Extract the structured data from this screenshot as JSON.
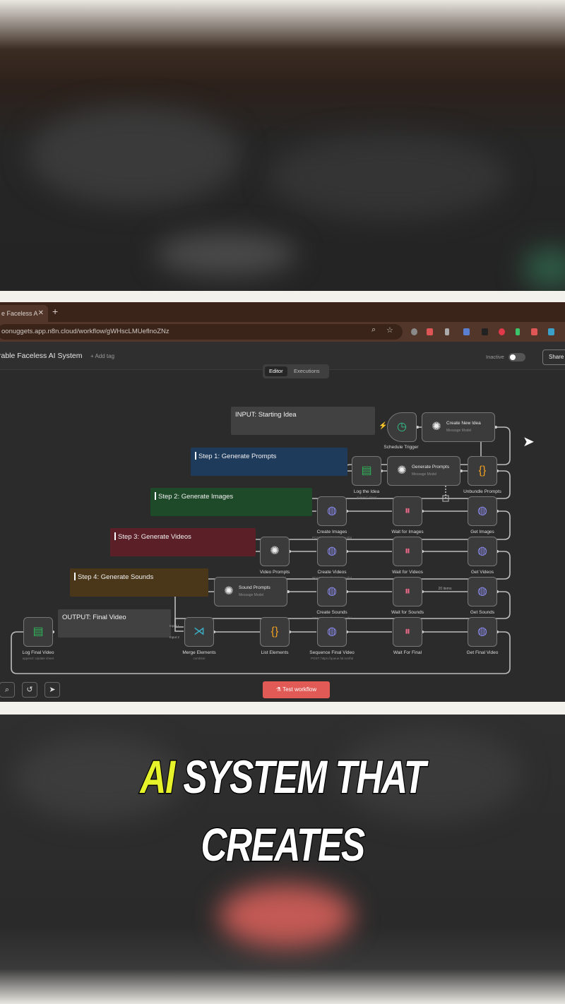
{
  "browser": {
    "tab_title": "e Faceless A",
    "tab_close": "✕",
    "new_tab": "+",
    "url": "oonuggets.app.n8n.cloud/workflow/gWHscLMUeflnoZNz"
  },
  "app": {
    "workflow_name": "rable Faceless AI System",
    "add_tag": "+ Add tag",
    "status": "Inactive",
    "share": "Share",
    "tabs": [
      "Editor",
      "Executions"
    ]
  },
  "stickies": {
    "input": "INPUT: Starting Idea",
    "step1": "Step 1: Generate Prompts",
    "step2": "Step 2: Generate Images",
    "step3": "Step 3: Generate Videos",
    "step4": "Step 4: Generate Sounds",
    "output": "OUTPUT: Final Video"
  },
  "nodes": {
    "schedule_trigger": {
      "label": "Schedule Trigger",
      "icon": "clock-icon"
    },
    "create_new_idea": {
      "title": "Create New Idea",
      "subtitle": "Message Model",
      "icon": "openai-icon"
    },
    "log_the_idea": {
      "label": "Log the Idea",
      "subtitle": "append: sheet",
      "icon": "google-sheets-icon"
    },
    "generate_prompts": {
      "title": "Generate Prompts",
      "subtitle": "Message Model",
      "icon": "openai-icon"
    },
    "unbundle_prompts": {
      "label": "Unbundle Prompts",
      "icon": "code-braces-icon"
    },
    "create_images": {
      "label": "Create Images",
      "subtitle": "POST: https://api.dev.run/fal",
      "icon": "globe-icon"
    },
    "wait_images": {
      "label": "Wait for Images",
      "icon": "pause-icon"
    },
    "get_images": {
      "label": "Get Images",
      "icon": "globe-icon"
    },
    "video_prompts": {
      "label": "Video Prompts",
      "subtitle": "Message Model",
      "icon": "openai-icon"
    },
    "create_videos": {
      "label": "Create Videos",
      "subtitle": "POST: https://api.dev.run/fal",
      "icon": "globe-icon"
    },
    "wait_videos": {
      "label": "Wait for Videos",
      "icon": "pause-icon"
    },
    "get_videos": {
      "label": "Get Videos",
      "icon": "globe-icon"
    },
    "sound_prompts": {
      "title": "Sound Prompts",
      "subtitle": "Message Model",
      "icon": "openai-icon"
    },
    "create_sounds": {
      "label": "Create Sounds",
      "subtitle": "POST: https://api.dev.run/fal",
      "icon": "globe-icon"
    },
    "wait_sounds": {
      "label": "Wait for Sounds",
      "icon": "pause-icon"
    },
    "get_sounds": {
      "label": "Get Sounds",
      "icon": "globe-icon"
    },
    "log_final_video": {
      "label": "Log Final Video",
      "subtitle": "append: Update sheet",
      "icon": "google-sheets-icon"
    },
    "merge_elements": {
      "label": "Merge Elements",
      "subtitle": "combine",
      "icon": "merge-icon"
    },
    "list_elements": {
      "label": "List Elements",
      "icon": "code-braces-icon"
    },
    "sequence_final_video": {
      "label": "Sequence Final Video",
      "subtitle": "POST: https://queue.fal.run/fal",
      "icon": "globe-icon"
    },
    "wait_final": {
      "label": "Wait For Final",
      "icon": "pause-icon"
    },
    "get_final_video": {
      "label": "Get Final Video",
      "icon": "globe-icon"
    }
  },
  "wire_labels": {
    "items": "20 items",
    "input1": "Input 1",
    "input2": "Input 2"
  },
  "controls": {
    "zoom": "⌕",
    "undo": "↺",
    "select": "➤"
  },
  "test_workflow": "Test workflow",
  "caption": {
    "line1_accent": "AI",
    "line1_rest": " SYSTEM THAT",
    "line2": "CREATES"
  },
  "colors": {
    "step1": "#1f3b5c",
    "step2": "#1f4a2a",
    "step3": "#5a1f27",
    "step4": "#4a3719",
    "accent": "#e6f22a",
    "test_button": "#e25a55"
  }
}
